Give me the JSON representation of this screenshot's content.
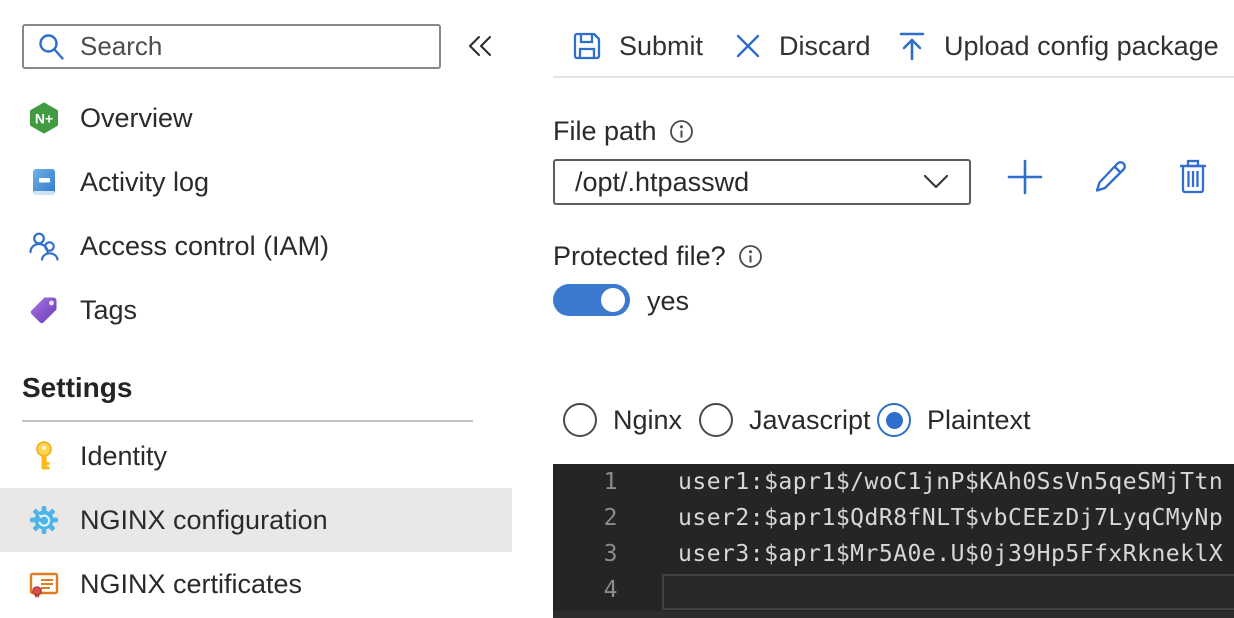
{
  "sidebar": {
    "search": {
      "placeholder": "Search"
    },
    "items": [
      {
        "label": "Overview"
      },
      {
        "label": "Activity log"
      },
      {
        "label": "Access control (IAM)"
      },
      {
        "label": "Tags"
      }
    ],
    "settings_section": {
      "header": "Settings",
      "items": [
        {
          "label": "Identity"
        },
        {
          "label": "NGINX configuration"
        },
        {
          "label": "NGINX certificates"
        }
      ],
      "selected_item": "NGINX configuration"
    }
  },
  "toolbar": {
    "submit_label": "Submit",
    "discard_label": "Discard",
    "upload_label": "Upload config package"
  },
  "form": {
    "file_path": {
      "label": "File path",
      "value": "/opt/.htpasswd"
    },
    "protected_file": {
      "label": "Protected file?",
      "state_label": "yes",
      "on": true
    },
    "syntax_options": [
      {
        "label": "Nginx",
        "selected": false
      },
      {
        "label": "Javascript",
        "selected": false
      },
      {
        "label": "Plaintext",
        "selected": true
      }
    ]
  },
  "editor": {
    "lines": [
      {
        "number": "1",
        "text": "user1:$apr1$/woC1jnP$KAh0SsVn5qeSMjTtn"
      },
      {
        "number": "2",
        "text": "user2:$apr1$QdR8fNLT$vbCEEzDj7LyqCMyNp"
      },
      {
        "number": "3",
        "text": "user3:$apr1$Mr5A0e.U$0j39Hp5FfxRkneklX"
      },
      {
        "number": "4",
        "text": ""
      }
    ]
  },
  "colors": {
    "accent_blue": "#2f6ecb",
    "toggle_blue": "#3a79cd",
    "gear_blue": "#4db4e8",
    "nginx_green": "#429a41",
    "tag_purple": "#8a5fd1",
    "key_gold": "#fdb913",
    "certificate_orange": "#dd7c20",
    "selected_row_bg": "#e9e8e7",
    "editor_bg": "#252526",
    "editor_text": "#d7d7d7",
    "editor_line_numbers": "#8c8c8c"
  }
}
